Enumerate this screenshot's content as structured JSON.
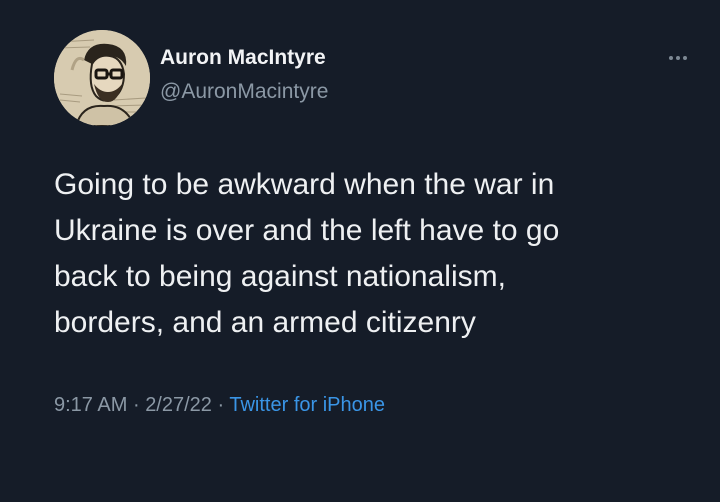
{
  "tweet": {
    "author_name": "Auron MacIntyre",
    "author_handle": "@AuronMacintyre",
    "text_lines": [
      "Going to be awkward when the war in",
      "Ukraine is over and the left have to go",
      "back to being against nationalism,",
      "borders, and an armed citizenry"
    ],
    "time": "9:17 AM",
    "separator": "·",
    "date": "2/27/22",
    "source": "Twitter for iPhone",
    "more_icon": "more-horizontal-icon",
    "avatar_icon": "avatar-illustration"
  },
  "colors": {
    "background": "#151c28",
    "text": "#eef0f2",
    "secondary": "#8b98a5",
    "link": "#3a95e6"
  }
}
